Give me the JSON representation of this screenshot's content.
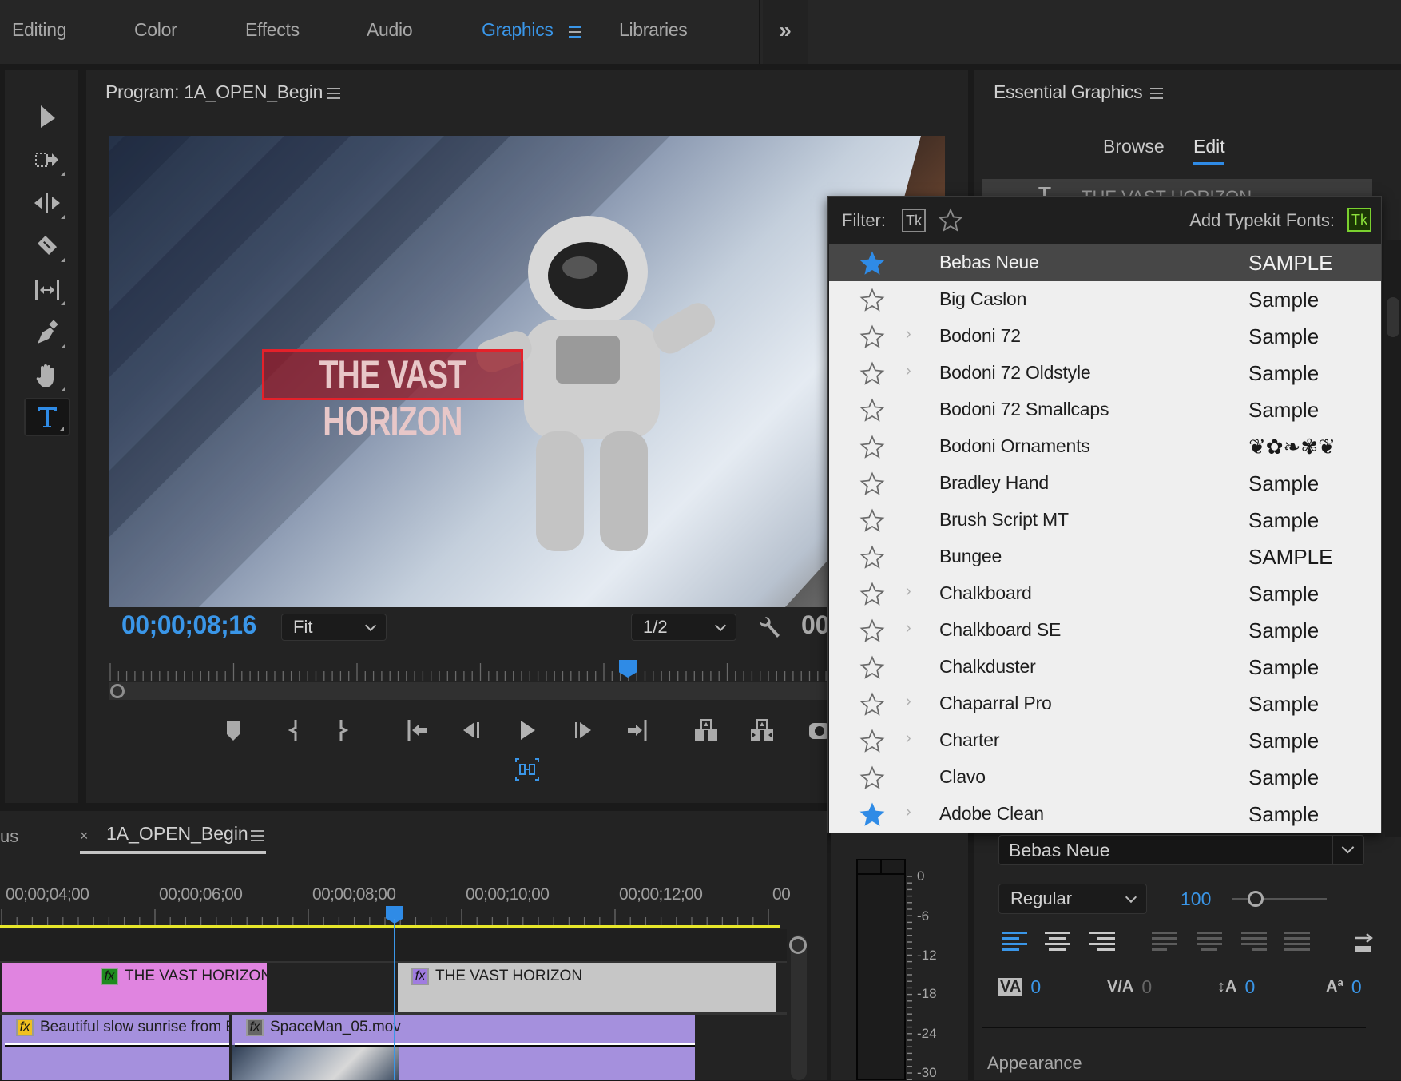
{
  "workspace_tabs": [
    {
      "label": "Editing",
      "active": false
    },
    {
      "label": "Color",
      "active": false
    },
    {
      "label": "Effects",
      "active": false
    },
    {
      "label": "Audio",
      "active": false
    },
    {
      "label": "Graphics",
      "active": true
    },
    {
      "label": "Libraries",
      "active": false
    }
  ],
  "workspace_more": "»",
  "tools": [
    "selection-tool",
    "track-select-tool",
    "ripple-edit-tool",
    "razor-tool",
    "slip-tool",
    "pen-tool",
    "hand-tool",
    "type-tool"
  ],
  "active_tool": "type-tool",
  "program": {
    "title": "Program: 1A_OPEN_Begin",
    "overlay_title": "THE VAST HORIZON",
    "timecode": "00;00;08;16",
    "zoom_select": "Fit",
    "resolution_select": "1/2",
    "duration_partial": "00",
    "playhead_fraction": 0.64
  },
  "essential_graphics": {
    "title": "Essential Graphics",
    "tabs": [
      {
        "label": "Browse",
        "active": false
      },
      {
        "label": "Edit",
        "active": true
      }
    ],
    "layer_name": "THE VAST HORIZON",
    "font": "Bebas Neue",
    "style": "Regular",
    "size": "100",
    "size_slider_fraction": 0.18,
    "tracking": "0",
    "kerning": "0",
    "leading": "0",
    "baseline_shift": "0",
    "appearance_label": "Appearance"
  },
  "font_menu": {
    "filter_label": "Filter:",
    "filter_tk": "Tk",
    "add_typekit_label": "Add Typekit Fonts:",
    "add_tk": "Tk",
    "fonts": [
      {
        "name": "Bebas Neue",
        "sample": "SAMPLE",
        "favorite": true,
        "expandable": false,
        "selected": true
      },
      {
        "name": "Big Caslon",
        "sample": "Sample",
        "favorite": false,
        "expandable": false
      },
      {
        "name": "Bodoni 72",
        "sample": "Sample",
        "favorite": false,
        "expandable": true
      },
      {
        "name": "Bodoni 72 Oldstyle",
        "sample": "Sample",
        "favorite": false,
        "expandable": true
      },
      {
        "name": "Bodoni 72 Smallcaps",
        "sample": "Sample",
        "favorite": false,
        "expandable": false
      },
      {
        "name": "Bodoni Ornaments",
        "sample": "❦✿❧✾❦",
        "favorite": false,
        "expandable": false
      },
      {
        "name": "Bradley Hand",
        "sample": "Sample",
        "favorite": false,
        "expandable": false
      },
      {
        "name": "Brush Script MT",
        "sample": "Sample",
        "favorite": false,
        "expandable": false
      },
      {
        "name": "Bungee",
        "sample": "SAMPLE",
        "favorite": false,
        "expandable": false
      },
      {
        "name": "Chalkboard",
        "sample": "Sample",
        "favorite": false,
        "expandable": true
      },
      {
        "name": "Chalkboard SE",
        "sample": "Sample",
        "favorite": false,
        "expandable": true
      },
      {
        "name": "Chalkduster",
        "sample": "Sample",
        "favorite": false,
        "expandable": false
      },
      {
        "name": "Chaparral Pro",
        "sample": "Sample",
        "favorite": false,
        "expandable": true
      },
      {
        "name": "Charter",
        "sample": "Sample",
        "favorite": false,
        "expandable": true
      },
      {
        "name": "Clavo",
        "sample": "Sample",
        "favorite": false,
        "expandable": false
      },
      {
        "name": "Adobe Clean",
        "sample": "Sample",
        "favorite": true,
        "expandable": true
      }
    ]
  },
  "timeline": {
    "prev_tab_partial": "us",
    "title": "1A_OPEN_Begin",
    "timecodes": [
      "00;00;04;00",
      "00;00;06;00",
      "00;00;08;00",
      "00;00;10;00",
      "00;00;12;00",
      "00"
    ],
    "clips": [
      {
        "name": "THE VAST HORIZON",
        "track": "V2",
        "color": "#e084e0",
        "fx_color": "#1f8a1f"
      },
      {
        "name": "THE VAST HORIZON",
        "track": "V2",
        "color": "#c6c6c6",
        "fx_color": "#a07ce0"
      },
      {
        "name": "Beautiful slow sunrise from E",
        "track": "V1",
        "color": "#a590dd",
        "fx_color": "#f0c020"
      },
      {
        "name": "SpaceMan_05.mov",
        "track": "V1",
        "color": "#a590dd",
        "fx_color": "#666666"
      }
    ]
  },
  "audio_meter": {
    "labels": [
      "0",
      "-6",
      "-12",
      "-18",
      "-24",
      "-30"
    ]
  },
  "colors": {
    "accent": "#3a96e8",
    "typekit_green": "#7ad12f",
    "title_red": "#e4212a"
  }
}
